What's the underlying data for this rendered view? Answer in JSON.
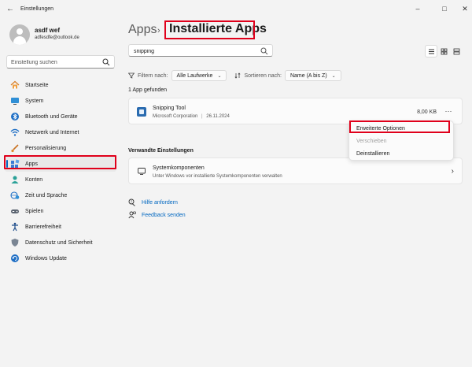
{
  "window": {
    "title": "Einstellungen",
    "back_glyph": "←",
    "controls": {
      "minimize": "–",
      "maximize": "□",
      "close": "✕"
    }
  },
  "profile": {
    "name": "asdf wef",
    "email": "adfesdfe@outlook.de"
  },
  "sidebar_search": {
    "placeholder": "Einstellung suchen"
  },
  "nav": {
    "items": [
      {
        "label": "Startseite",
        "icon": "home-icon"
      },
      {
        "label": "System",
        "icon": "monitor-icon"
      },
      {
        "label": "Bluetooth und Geräte",
        "icon": "bluetooth-icon"
      },
      {
        "label": "Netzwerk und Internet",
        "icon": "wifi-icon"
      },
      {
        "label": "Personalisierung",
        "icon": "brush-icon"
      },
      {
        "label": "Apps",
        "icon": "apps-icon"
      },
      {
        "label": "Konten",
        "icon": "person-icon"
      },
      {
        "label": "Zeit und Sprache",
        "icon": "globe-clock-icon"
      },
      {
        "label": "Spielen",
        "icon": "gamepad-icon"
      },
      {
        "label": "Barrierefreiheit",
        "icon": "accessibility-icon"
      },
      {
        "label": "Datenschutz und Sicherheit",
        "icon": "shield-icon"
      },
      {
        "label": "Windows Update",
        "icon": "update-icon"
      }
    ],
    "active_label": "Apps"
  },
  "breadcrumb": {
    "root": "Apps",
    "separator": "›",
    "current": "Installierte Apps"
  },
  "app_search": {
    "value": "snipping"
  },
  "filters": {
    "filter_label": "Filtern nach:",
    "filter_value": "Alle Laufwerke",
    "sort_label": "Sortieren nach:",
    "sort_value": "Name (A bis Z)"
  },
  "results": {
    "count_text": "1 App gefunden"
  },
  "app": {
    "name": "Snipping Tool",
    "publisher": "Microsoft Corporation",
    "separator": "|",
    "date": "26.11.2024",
    "size": "8,00 KB",
    "more_glyph": "···"
  },
  "context_menu": {
    "items": [
      {
        "label": "Erweiterte Optionen",
        "enabled": true
      },
      {
        "label": "Verschieben",
        "enabled": false
      },
      {
        "label": "Deinstallieren",
        "enabled": true
      }
    ]
  },
  "related": {
    "title": "Verwandte Einstellungen",
    "item_title": "Systemkomponenten",
    "item_subtitle": "Unter Windows vor installierte Systemkomponenten verwalten",
    "chevron": "›"
  },
  "links": {
    "help": "Hilfe anfordern",
    "feedback": "Feedback senden"
  },
  "colors": {
    "accent": "#0067c0",
    "highlight": "#e0001b",
    "background": "#f3f3f3"
  }
}
